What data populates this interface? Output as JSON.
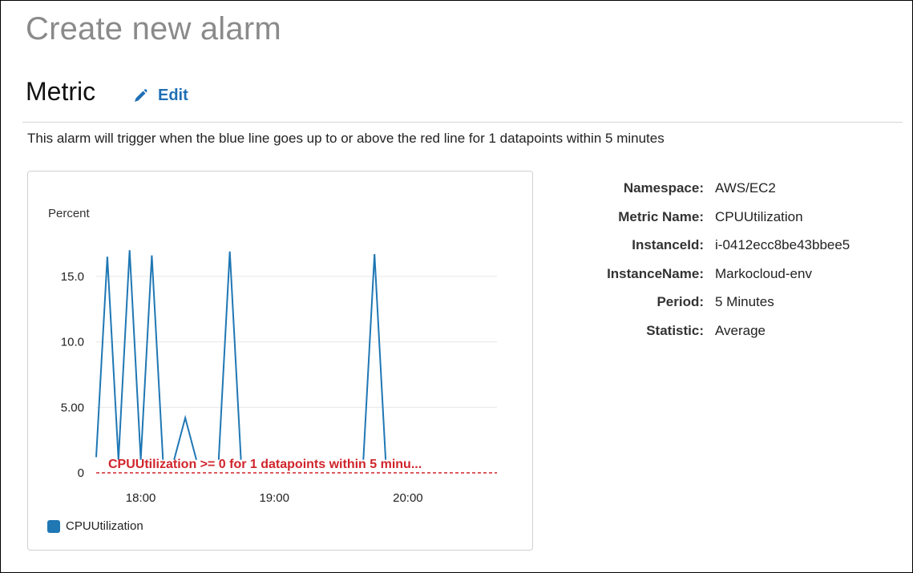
{
  "page": {
    "title": "Create new alarm",
    "section_title": "Metric",
    "edit_label": "Edit",
    "description": "This alarm will trigger when the blue line goes up to or above the red line for 1 datapoints within 5 minutes"
  },
  "details": [
    {
      "key": "Namespace:",
      "value": "AWS/EC2"
    },
    {
      "key": "Metric Name:",
      "value": "CPUUtilization"
    },
    {
      "key": "InstanceId:",
      "value": "i-0412ecc8be43bbee5"
    },
    {
      "key": "InstanceName:",
      "value": "Markocloud-env"
    },
    {
      "key": "Period:",
      "value": "5 Minutes"
    },
    {
      "key": "Statistic:",
      "value": "Average"
    }
  ],
  "colors": {
    "series": "#1f77b4",
    "threshold": "#d0242b",
    "link": "#1f6fb5"
  },
  "chart_data": {
    "type": "line",
    "ylabel": "Percent",
    "ylim": [
      0,
      17.5
    ],
    "y_ticks": [
      0,
      5.0,
      10.0,
      15.0
    ],
    "y_tick_labels": [
      "0",
      "5.00",
      "10.0",
      "15.0"
    ],
    "x_ticks": [
      "17:40",
      "18:00",
      "19:00",
      "20:00"
    ],
    "x_tick_labels": [
      "18:00",
      "19:00",
      "20:00"
    ],
    "x_tick_values": [
      "18:00",
      "19:00",
      "20:00"
    ],
    "xlim": [
      "17:40",
      "20:40"
    ],
    "grid": true,
    "series": [
      {
        "name": "CPUUtilization",
        "segments": [
          [
            [
              "17:40",
              1.2
            ],
            [
              "17:45",
              16.5
            ],
            [
              "17:50",
              1.0
            ],
            [
              "17:55",
              17.0
            ],
            [
              "18:00",
              1.0
            ],
            [
              "18:05",
              16.6
            ],
            [
              "18:10",
              1.0
            ]
          ],
          [
            [
              "18:15",
              1.0
            ],
            [
              "18:20",
              4.2
            ],
            [
              "18:25",
              1.0
            ]
          ],
          [
            [
              "18:35",
              1.0
            ],
            [
              "18:40",
              16.9
            ],
            [
              "18:45",
              1.0
            ]
          ],
          [
            [
              "19:40",
              1.0
            ],
            [
              "19:45",
              16.7
            ],
            [
              "19:50",
              1.0
            ]
          ]
        ]
      }
    ],
    "threshold": {
      "value": 0,
      "label": "CPUUtilization >= 0 for 1 datapoints within 5 minu..."
    },
    "legend": [
      "CPUUtilization"
    ],
    "legend_position": "bottom-left"
  }
}
